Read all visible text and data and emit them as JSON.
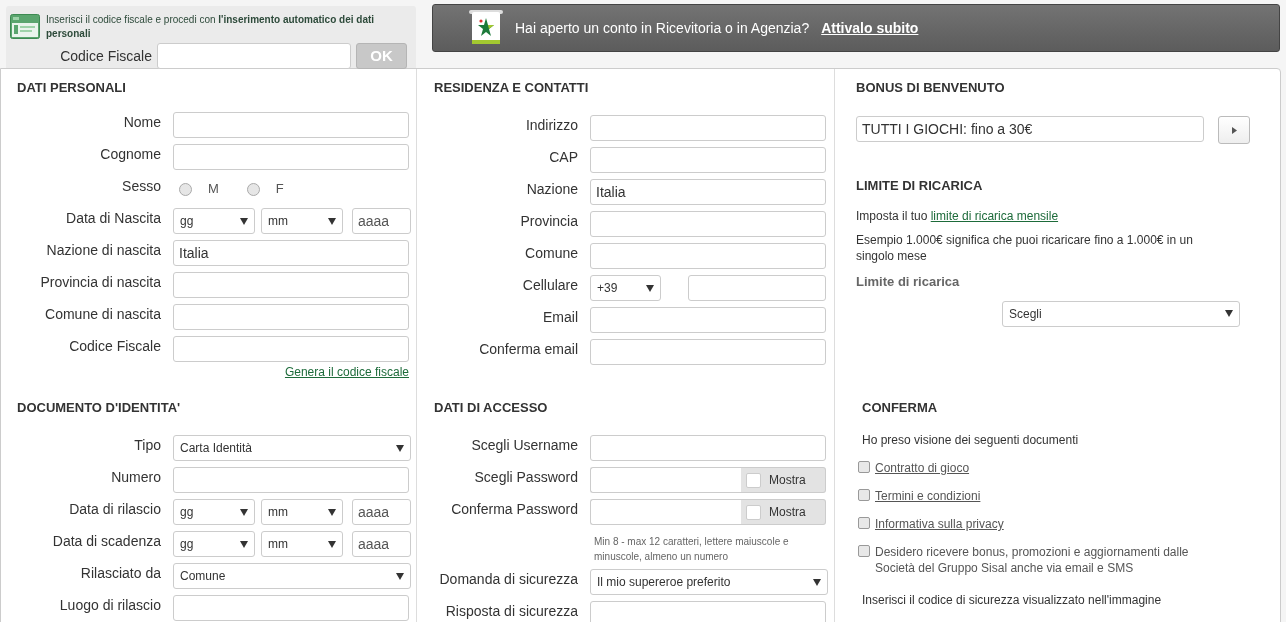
{
  "cf_box": {
    "text": "Inserisci il codice fiscale e procedi con **l'inserimento automatico dei dati personali**",
    "label": "Codice Fiscale",
    "button": "OK"
  },
  "banner": {
    "text": "Hai aperto un conto in Ricevitoria o in Agenzia?",
    "link": "Attivalo subito"
  },
  "dati_personali": {
    "title": "DATI PERSONALI",
    "rows": [
      {
        "kind": "text",
        "label": "Nome"
      },
      {
        "kind": "text",
        "label": "Cognome"
      },
      {
        "kind": "radio",
        "label": "Sesso",
        "options": [
          {
            "label": "M",
            "selected": false
          },
          {
            "label": "F",
            "selected": false
          }
        ]
      },
      {
        "kind": "date",
        "label": "Data di Nascita",
        "day": "gg",
        "month": "mm",
        "year_placeholder": "aaaa"
      },
      {
        "kind": "text",
        "label": "Nazione di nascita",
        "value": "Italia"
      },
      {
        "kind": "text",
        "label": "Provincia di nascita"
      },
      {
        "kind": "text",
        "label": "Comune di nascita"
      },
      {
        "kind": "text",
        "label": "Codice Fiscale"
      }
    ],
    "link": "Genera il codice fiscale"
  },
  "documento": {
    "title": "DOCUMENTO D'IDENTITA'",
    "rows": [
      {
        "kind": "select",
        "label": "Tipo",
        "value": "Carta Identità"
      },
      {
        "kind": "text",
        "label": "Numero"
      },
      {
        "kind": "date",
        "label": "Data di rilascio",
        "day": "gg",
        "month": "mm",
        "year_placeholder": "aaaa"
      },
      {
        "kind": "date",
        "label": "Data di scadenza",
        "day": "gg",
        "month": "mm",
        "year_placeholder": "aaaa"
      },
      {
        "kind": "select",
        "label": "Rilasciato da",
        "value": "Comune"
      },
      {
        "kind": "text",
        "label": "Luogo di rilascio"
      }
    ]
  },
  "residenza": {
    "title": "RESIDENZA E CONTATTI",
    "rows": [
      {
        "kind": "text",
        "label": "Indirizzo"
      },
      {
        "kind": "text",
        "label": "CAP"
      },
      {
        "kind": "text",
        "label": "Nazione",
        "value": "Italia"
      },
      {
        "kind": "text",
        "label": "Provincia"
      },
      {
        "kind": "text",
        "label": "Comune"
      },
      {
        "kind": "phone",
        "label": "Cellulare",
        "prefix": "+39"
      },
      {
        "kind": "text",
        "label": "Email"
      },
      {
        "kind": "text",
        "label": "Conferma email"
      }
    ]
  },
  "accesso": {
    "title": "DATI DI ACCESSO",
    "rows": [
      {
        "kind": "text",
        "label": "Scegli Username"
      },
      {
        "kind": "password",
        "label": "Scegli Password",
        "toggle": {
          "label": "Mostra",
          "checked": false
        }
      },
      {
        "kind": "password",
        "label": "Conferma Password",
        "toggle": {
          "label": "Mostra",
          "checked": false
        }
      },
      {
        "kind": "hint",
        "text": "Min 8 - max 12 caratteri, lettere maiuscole e minuscole, almeno un numero"
      },
      {
        "kind": "select",
        "label": "Domanda di sicurezza",
        "value": "Il mio supereroe preferito"
      },
      {
        "kind": "text",
        "label": "Risposta di sicurezza"
      }
    ]
  },
  "bonus": {
    "title": "BONUS DI BENVENUTO",
    "value": "TUTTI I GIOCHI: fino a 30€"
  },
  "limite": {
    "title": "LIMITE DI RICARICA",
    "intro": "Imposta il tuo",
    "intro_link": "limite di ricarica mensile",
    "example": "Esempio 1.000€ significa che puoi ricaricare fino a 1.000€ in un singolo mese",
    "label": "Limite di ricarica",
    "select": "Scegli"
  },
  "conferma": {
    "title": "CONFERMA",
    "intro": "Ho preso visione dei seguenti documenti",
    "items": [
      {
        "kind": "link",
        "text": "Contratto di gioco",
        "checked": false
      },
      {
        "kind": "link",
        "text": "Termini e condizioni",
        "checked": false
      },
      {
        "kind": "link",
        "text": "Informativa sulla privacy",
        "checked": false
      },
      {
        "kind": "plain",
        "text": "Desidero ricevere bonus, promozioni e aggiornamenti dalle Società del Gruppo Sisal anche via email e SMS",
        "checked": false
      }
    ],
    "captcha": "Inserisci il codice di sicurezza visualizzato nell'immagine"
  }
}
